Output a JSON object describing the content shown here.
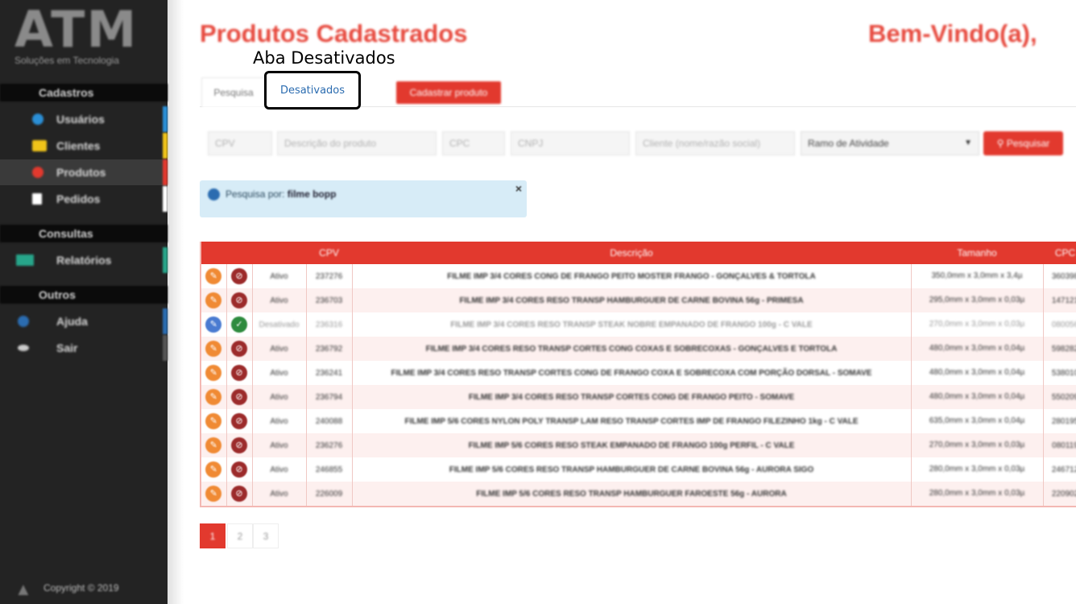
{
  "sidebar": {
    "logo_text": "ATM",
    "logo_tagline": "Soluções em Tecnologia",
    "sections": [
      {
        "title": "Cadastros"
      },
      {
        "title": "Consultas"
      },
      {
        "title": "Outros"
      }
    ],
    "items": [
      {
        "label": "Usuários",
        "icon": "user-icon",
        "color": "#2b8fd6"
      },
      {
        "label": "Clientes",
        "icon": "envelope-icon",
        "color": "#f0c419"
      },
      {
        "label": "Produtos",
        "icon": "circle-icon",
        "color": "#e2392e"
      },
      {
        "label": "Pedidos",
        "icon": "document-icon",
        "color": "#ffffff"
      },
      {
        "label": "Relatórios",
        "icon": "chart-icon",
        "color": "#27a58a"
      },
      {
        "label": "Ajuda",
        "icon": "help-icon",
        "color": "#2b6cb0"
      },
      {
        "label": "Sair",
        "icon": "exit-icon",
        "color": "#cccccc"
      }
    ],
    "copyright": "Copyright © 2019"
  },
  "header": {
    "title": "Produtos Cadastrados",
    "welcome": "Bem-Vindo(a),"
  },
  "annotation": {
    "label": "Aba Desativados"
  },
  "tabs": {
    "pesquisa": "Pesquisa",
    "desativados": "Desativados",
    "cadastrar": "Cadastrar produto"
  },
  "search": {
    "cpv_placeholder": "CPV",
    "descricao_placeholder": "Descrição do produto",
    "cpc_placeholder": "CPC",
    "cnpj_placeholder": "CNPJ",
    "cliente_placeholder": "Cliente (nome/razão social)",
    "ramo_selected": "Ramo de Atividade",
    "pesquisar_label": "Pesquisar"
  },
  "alert": {
    "prefix": "Pesquisa por:",
    "term": "filme bopp"
  },
  "table": {
    "headers": [
      "",
      "",
      "",
      "CPV",
      "Descrição",
      "Tamanho",
      "CPC"
    ],
    "rows": [
      {
        "status": "Ativo",
        "cpv": "237276",
        "desc": "FILME IMP 3/4 CORES CONG DE FRANGO PEITO MOSTER FRANGO - GONÇALVES & TORTOLA",
        "tamanho": "350,0mm x 3,0mm x 3,4µ",
        "cpc": "360398"
      },
      {
        "status": "Ativo",
        "cpv": "236703",
        "desc": "FILME IMP 3/4 CORES RESO TRANSP HAMBURGUER DE CARNE BOVINA 56g - PRIMESA",
        "tamanho": "295,0mm x 3,0mm x 0,03µ",
        "cpc": "147121"
      },
      {
        "status": "Desativado",
        "cpv": "236316",
        "desc": "FILME IMP 3/4 CORES RESO TRANSP STEAK NOBRE EMPANADO DE FRANGO 100g - C VALE",
        "tamanho": "270,0mm x 3,0mm x 0,03µ",
        "cpc": "080056"
      },
      {
        "status": "Ativo",
        "cpv": "236792",
        "desc": "FILME IMP 3/4 CORES RESO TRANSP CORTES CONG COXAS E SOBRECOXAS - GONÇALVES E TORTOLA",
        "tamanho": "480,0mm x 3,0mm x 0,04µ",
        "cpc": "598282"
      },
      {
        "status": "Ativo",
        "cpv": "236241",
        "desc": "FILME IMP 3/4 CORES RESO TRANSP CORTES CONG DE FRANGO COXA E SOBRECOXA COM PORÇÃO DORSAL - SOMAVE",
        "tamanho": "480,0mm x 3,0mm x 0,04µ",
        "cpc": "538010"
      },
      {
        "status": "Ativo",
        "cpv": "236794",
        "desc": "FILME IMP 3/4 CORES RESO TRANSP CORTES CONG DE FRANGO PEITO - SOMAVE",
        "tamanho": "480,0mm x 3,0mm x 0,04µ",
        "cpc": "550209"
      },
      {
        "status": "Ativo",
        "cpv": "240088",
        "desc": "FILME IMP 5/6 CORES NYLON POLY TRANSP LAM RESO TRANSP CORTES IMP DE FRANGO FILEZINHO 1kg - C VALE",
        "tamanho": "635,0mm x 3,0mm x 0,04µ",
        "cpc": "280195"
      },
      {
        "status": "Ativo",
        "cpv": "236276",
        "desc": "FILME IMP 5/6 CORES RESO STEAK EMPANADO DE FRANGO 100g PERFIL - C VALE",
        "tamanho": "270,0mm x 3,0mm x 0,03µ",
        "cpc": "080119"
      },
      {
        "status": "Ativo",
        "cpv": "246855",
        "desc": "FILME IMP 5/6 CORES RESO TRANSP HAMBURGUER DE CARNE BOVINA 56g - AURORA SIGO",
        "tamanho": "280,0mm x 3,0mm x 0,03µ",
        "cpc": "246712"
      },
      {
        "status": "Ativo",
        "cpv": "226009",
        "desc": "FILME IMP 5/6 CORES RESO TRANSP HAMBURGUER FAROESTE 56g - AURORA",
        "tamanho": "280,0mm x 3,0mm x 0,03µ",
        "cpc": "220902"
      }
    ]
  },
  "pagination": [
    "1",
    "2",
    "3"
  ],
  "colors": {
    "accent": "#e2392e",
    "sidebar": "#232323",
    "info": "#d7ecf7"
  }
}
